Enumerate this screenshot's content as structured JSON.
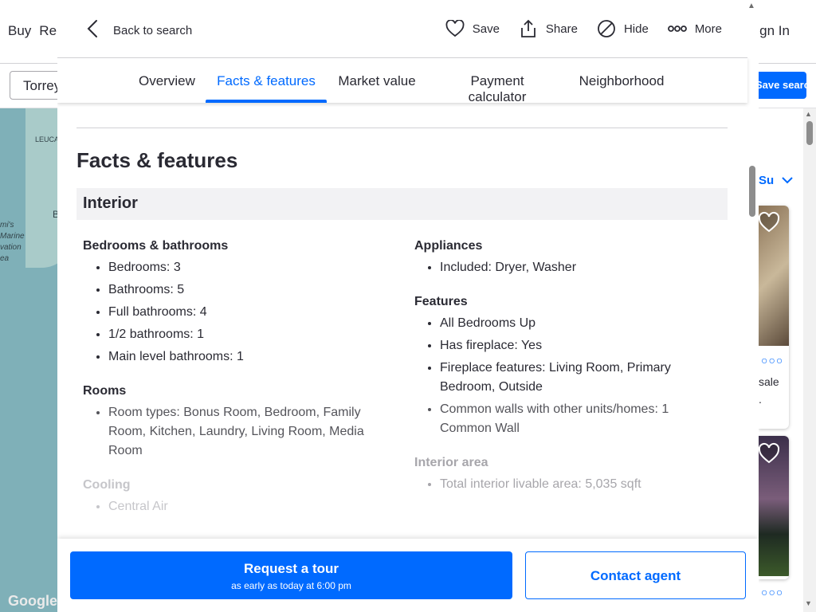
{
  "background": {
    "nav_left": [
      "Buy",
      "Re"
    ],
    "sign_in": "Sign In",
    "search_value": "Torrey",
    "save_search": "Save search",
    "map_labels": [
      "LEUCA",
      "Bi",
      "mi's",
      "Marine",
      "vation",
      "ea"
    ],
    "map_credit": "Google",
    "sort_label": "Su",
    "card_text": [
      "sale",
      "."
    ]
  },
  "topbar": {
    "back_label": "Back to search",
    "actions": {
      "save": "Save",
      "share": "Share",
      "hide": "Hide",
      "more": "More"
    }
  },
  "tabs": [
    {
      "label": "Overview",
      "active": false
    },
    {
      "label": "Facts & features",
      "active": true
    },
    {
      "label": "Market value",
      "active": false
    },
    {
      "label": "Payment calculator",
      "active": false
    },
    {
      "label": "Neighborhood",
      "active": false
    }
  ],
  "facts": {
    "title": "Facts & features",
    "interior_heading": "Interior",
    "bedrooms_bathrooms": {
      "heading": "Bedrooms & bathrooms",
      "items": [
        "Bedrooms: 3",
        "Bathrooms: 5",
        "Full bathrooms: 4",
        "1/2 bathrooms: 1",
        "Main level bathrooms: 1"
      ]
    },
    "rooms": {
      "heading": "Rooms",
      "items": [
        "Room types: Bonus Room, Bedroom, Family Room, Kitchen, Laundry, Living Room, Media Room"
      ]
    },
    "cooling": {
      "heading": "Cooling",
      "items": [
        "Central Air"
      ]
    },
    "appliances": {
      "heading": "Appliances",
      "items": [
        "Included: Dryer, Washer"
      ]
    },
    "features": {
      "heading": "Features",
      "items": [
        "All Bedrooms Up",
        "Has fireplace: Yes",
        "Fireplace features: Living Room, Primary Bedroom, Outside",
        "Common walls with other units/homes: 1 Common Wall"
      ]
    },
    "interior_area": {
      "heading": "Interior area",
      "items": [
        "Total interior livable area: 5,035 sqft"
      ]
    }
  },
  "footer": {
    "tour_title": "Request a tour",
    "tour_subtitle": "as early as today at 6:00 pm",
    "contact": "Contact agent"
  },
  "colors": {
    "accent": "#006aff",
    "text": "#2a2a33",
    "band": "#f2f2f4"
  }
}
